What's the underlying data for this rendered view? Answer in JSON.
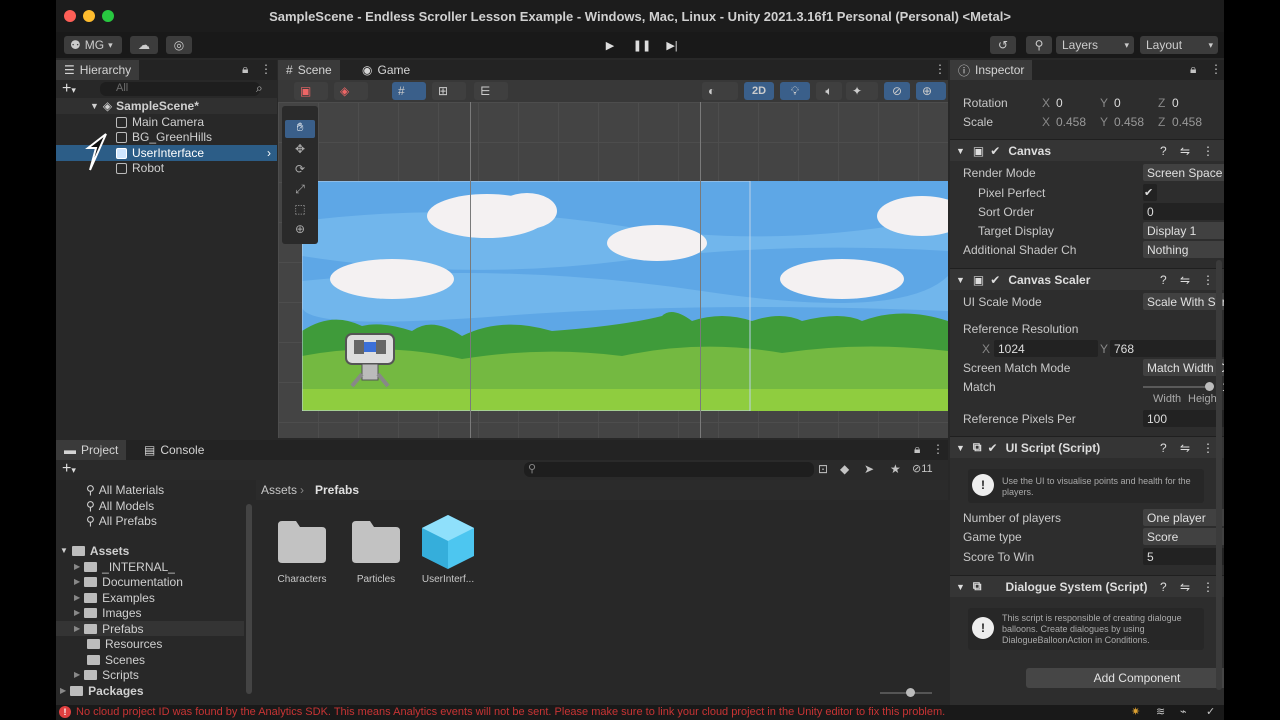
{
  "window": {
    "title": "SampleScene - Endless Scroller Lesson Example - Windows, Mac, Linux - Unity 2021.3.16f1 Personal (Personal) <Metal>"
  },
  "toolbar": {
    "account": "MG",
    "layers": "Layers",
    "layout": "Layout"
  },
  "hierarchy": {
    "tab": "Hierarchy",
    "search_placeholder": "All",
    "items": [
      "SampleScene*",
      "Main Camera",
      "BG_GreenHills",
      "UserInterface",
      "Robot"
    ]
  },
  "scene": {
    "tab_scene": "Scene",
    "tab_game": "Game",
    "mode_2d": "2D"
  },
  "inspector": {
    "tab": "Inspector",
    "transform": {
      "rotation_label": "Rotation",
      "scale_label": "Scale",
      "rot": [
        "0",
        "0",
        "0"
      ],
      "scale": [
        "0.458",
        "0.458",
        "0.458"
      ]
    },
    "canvas": {
      "title": "Canvas",
      "render_mode_label": "Render Mode",
      "render_mode": "Screen Space - Ov",
      "pixel_perfect_label": "Pixel Perfect",
      "sort_order_label": "Sort Order",
      "sort_order": "0",
      "target_display_label": "Target Display",
      "target_display": "Display 1",
      "shader_label": "Additional Shader Ch",
      "shader": "Nothing"
    },
    "scaler": {
      "title": "Canvas Scaler",
      "ui_scale_label": "UI Scale Mode",
      "ui_scale": "Scale With Screen",
      "ref_res_label": "Reference Resolution",
      "ref_x": "1024",
      "ref_y": "768",
      "match_mode_label": "Screen Match Mode",
      "match_mode": "Match Width Or He",
      "match_label": "Match",
      "match_value": "1",
      "match_fraction": 1,
      "width_label": "Width",
      "height_label": "Height",
      "ref_ppu_label": "Reference Pixels Per",
      "ref_ppu": "100"
    },
    "ui_script": {
      "title": "UI Script (Script)",
      "help": "Use the UI to visualise points and health for the players.",
      "players_label": "Number of players",
      "players": "One player",
      "game_type_label": "Game type",
      "game_type": "Score",
      "score_label": "Score To Win",
      "score": "5"
    },
    "dialogue": {
      "title": "Dialogue System (Script)",
      "help": "This script is responsible of creating dialogue balloons. Create dialogues by using DialogueBalloonAction in Conditions."
    },
    "add_component": "Add Component"
  },
  "project": {
    "tab_project": "Project",
    "tab_console": "Console",
    "hidden_count": "11",
    "favorites": [
      "All Materials",
      "All Models",
      "All Prefabs"
    ],
    "assets_root": "Assets",
    "asset_folders": [
      "_INTERNAL_",
      "Documentation",
      "Examples",
      "Images",
      "Prefabs",
      "Resources",
      "Scenes",
      "Scripts"
    ],
    "packages": "Packages",
    "breadcrumb": [
      "Assets",
      "Prefabs"
    ],
    "items": [
      "Characters",
      "Particles",
      "UserInterf..."
    ]
  },
  "status": {
    "message": "No cloud project ID was found by the Analytics SDK. This means Analytics events will not be sent. Please make sure to link your cloud project in the Unity editor to fix this problem."
  },
  "colors": {
    "selection": "#2c5d87",
    "accent": "#4a7cb0",
    "error": "#e04040",
    "sky": "#5ea7e6",
    "grass": "#5db338"
  }
}
